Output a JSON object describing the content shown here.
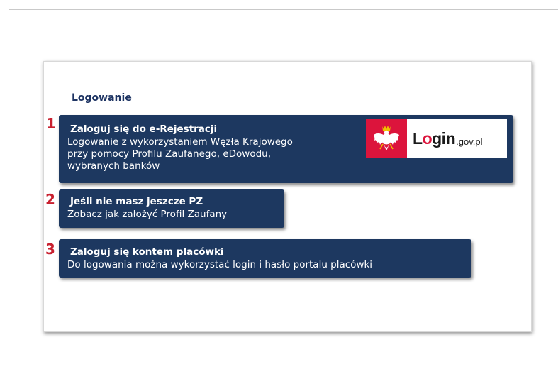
{
  "panel": {
    "title": "Logowanie"
  },
  "options": [
    {
      "number": "1",
      "title": "Zaloguj się do e-Rejestracji",
      "description": [
        "Logowanie z wykorzystaniem Węzła Krajowego",
        "przy pomocy Profilu Zaufanego, eDowodu,",
        "wybranych banków"
      ]
    },
    {
      "number": "2",
      "title": "Jeśli nie masz jeszcze PZ",
      "description": [
        "Zobacz jak założyć Profil Zaufany"
      ]
    },
    {
      "number": "3",
      "title": "Zaloguj się kontem placówki",
      "description": [
        "Do logowania można wykorzystać login i hasło portalu placówki"
      ]
    }
  ],
  "logo": {
    "big_prefix": "L",
    "big_o": "o",
    "big_suffix": "gin",
    "small": ".gov.pl",
    "emblem_icon": "polish-eagle-emblem"
  },
  "colors": {
    "option_bg": "#1d3860",
    "number": "#c8202f",
    "title": "#1f3564",
    "emblem_bg": "#dc143c"
  }
}
